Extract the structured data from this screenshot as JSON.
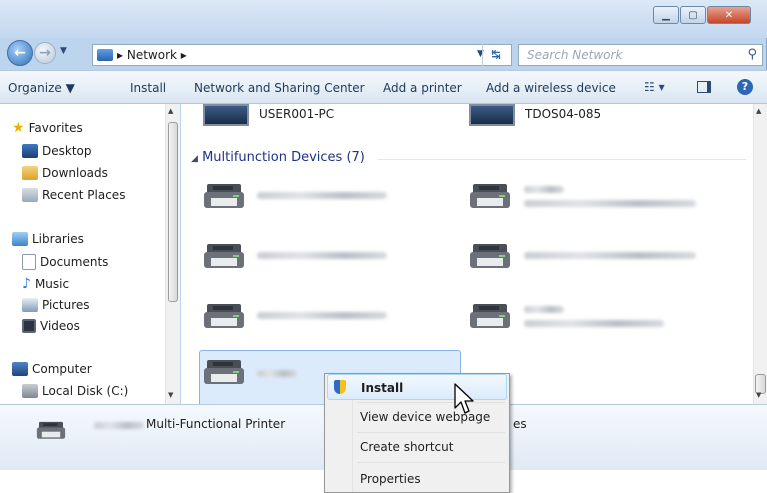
{
  "address": {
    "crumb": "Network",
    "search_placeholder": "Search Network"
  },
  "toolbar": {
    "organize": "Organize ▼",
    "install": "Install",
    "network_sharing": "Network and Sharing Center",
    "add_printer": "Add a printer",
    "add_wireless": "Add a wireless device"
  },
  "sidebar": {
    "favorites": "Favorites",
    "desktop": "Desktop",
    "downloads": "Downloads",
    "recent": "Recent Places",
    "libraries": "Libraries",
    "documents": "Documents",
    "music": "Music",
    "pictures": "Pictures",
    "videos": "Videos",
    "computer": "Computer",
    "local_disk": "Local Disk (C:)"
  },
  "computers": {
    "left": "USER001-PC",
    "right": "TDOS04-085"
  },
  "group": {
    "title": "Multifunction Devices (7)"
  },
  "details": {
    "type": "Multi-Functional Printer",
    "partial": "es"
  },
  "context_menu": {
    "install": "Install",
    "view_webpage": "View device webpage",
    "create_shortcut": "Create shortcut",
    "properties": "Properties"
  }
}
